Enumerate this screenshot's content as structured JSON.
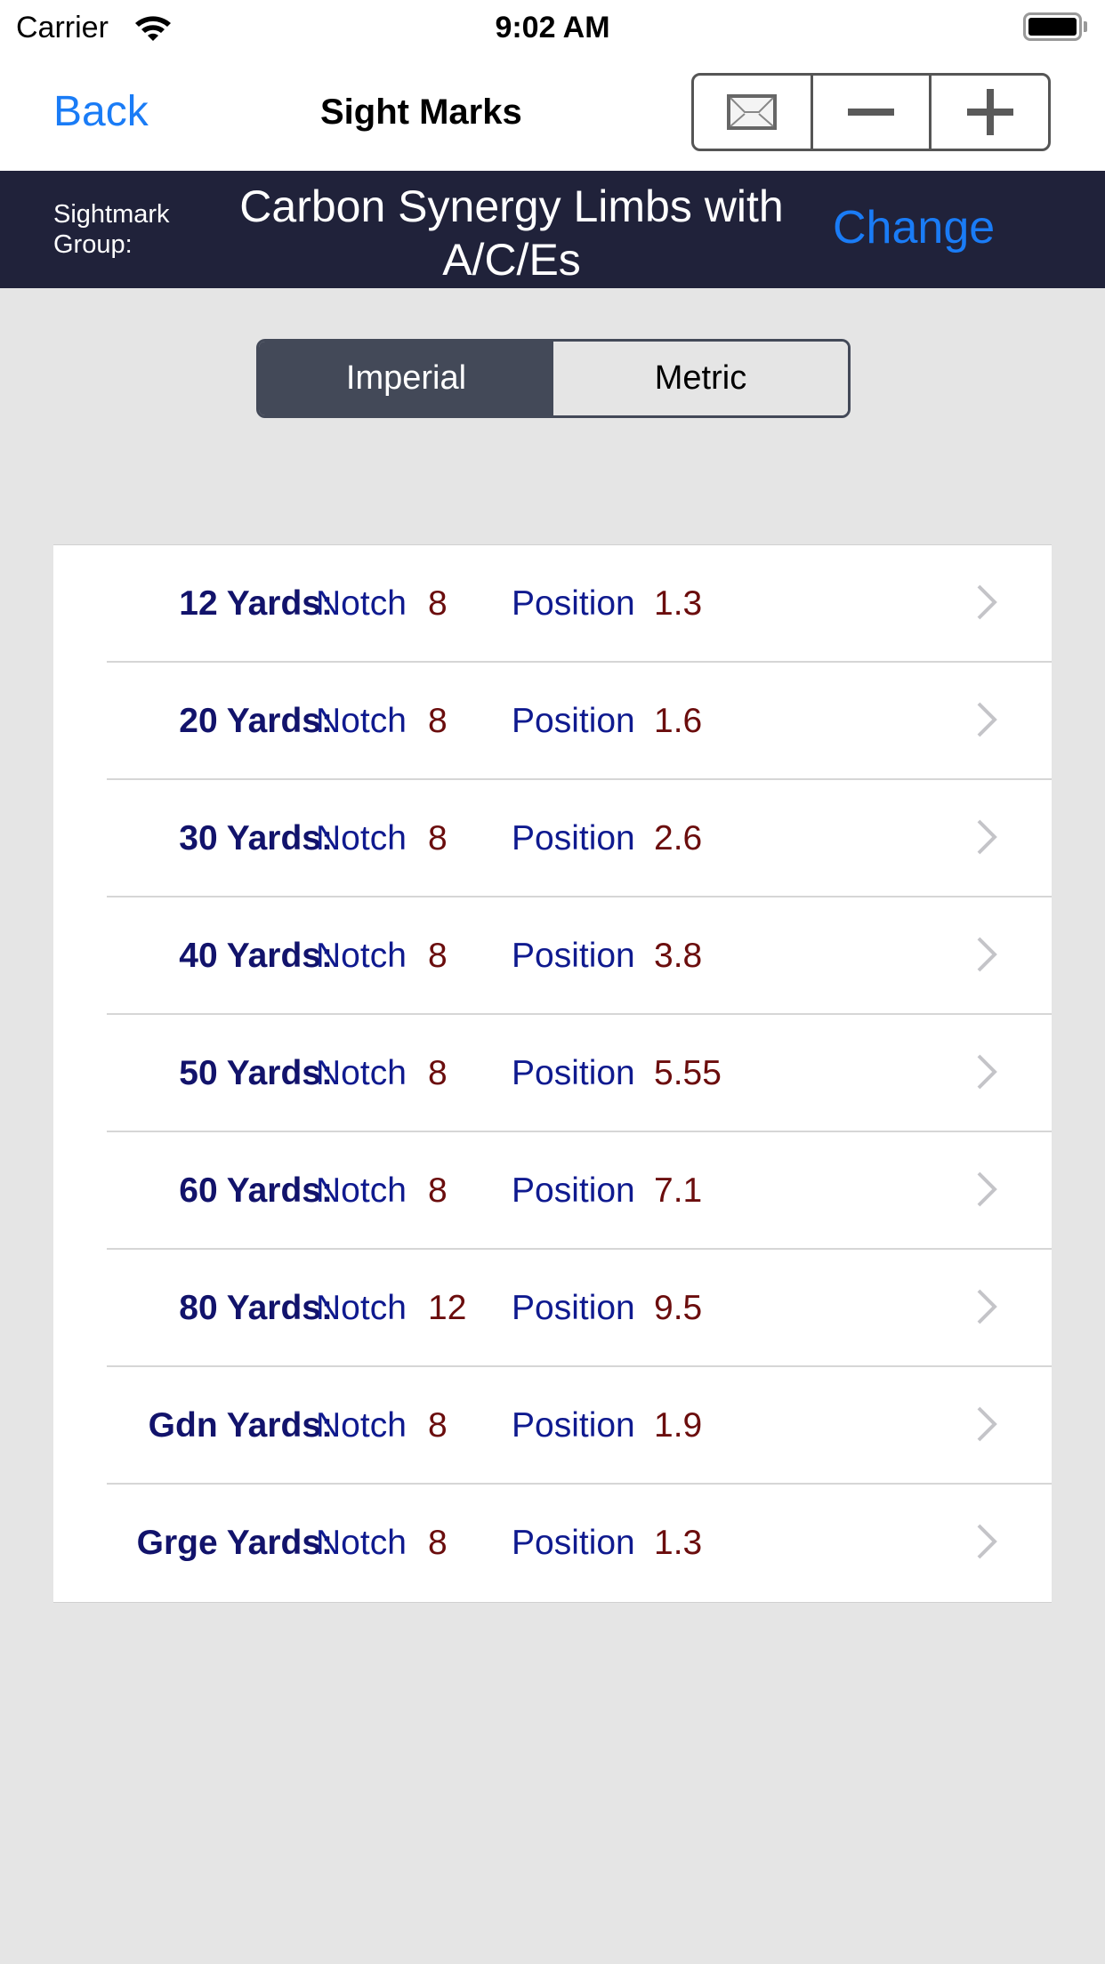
{
  "status_bar": {
    "carrier": "Carrier",
    "time": "9:02 AM"
  },
  "nav": {
    "back_label": "Back",
    "title": "Sight Marks",
    "tools": [
      {
        "icon": "mail-icon"
      },
      {
        "icon": "minus-icon"
      },
      {
        "icon": "plus-icon"
      }
    ]
  },
  "group": {
    "label": "Sightmark Group:",
    "name": "Carbon Synergy Limbs with A/C/Es",
    "change_label": "Change"
  },
  "units": {
    "options": [
      "Imperial",
      "Metric"
    ],
    "selected": "Imperial"
  },
  "colors": {
    "accent": "#1a7cf6",
    "header_bg": "#20223a",
    "segment_active": "#434958",
    "distance_text": "#12136b",
    "label_text": "#0f1a8f",
    "value_text": "#6b0d0d"
  },
  "labels": {
    "notch": "Notch",
    "position": "Position"
  },
  "sight_marks": [
    {
      "distance": "12 Yards:",
      "notch": "8",
      "position": "1.3"
    },
    {
      "distance": "20 Yards:",
      "notch": "8",
      "position": "1.6"
    },
    {
      "distance": "30 Yards:",
      "notch": "8",
      "position": "2.6"
    },
    {
      "distance": "40 Yards:",
      "notch": "8",
      "position": "3.8"
    },
    {
      "distance": "50 Yards:",
      "notch": "8",
      "position": "5.55"
    },
    {
      "distance": "60 Yards:",
      "notch": "8",
      "position": "7.1"
    },
    {
      "distance": "80 Yards:",
      "notch": "12",
      "position": "9.5"
    },
    {
      "distance": "Gdn Yards:",
      "notch": "8",
      "position": "1.9"
    },
    {
      "distance": "Grge Yards:",
      "notch": "8",
      "position": "1.3"
    }
  ]
}
